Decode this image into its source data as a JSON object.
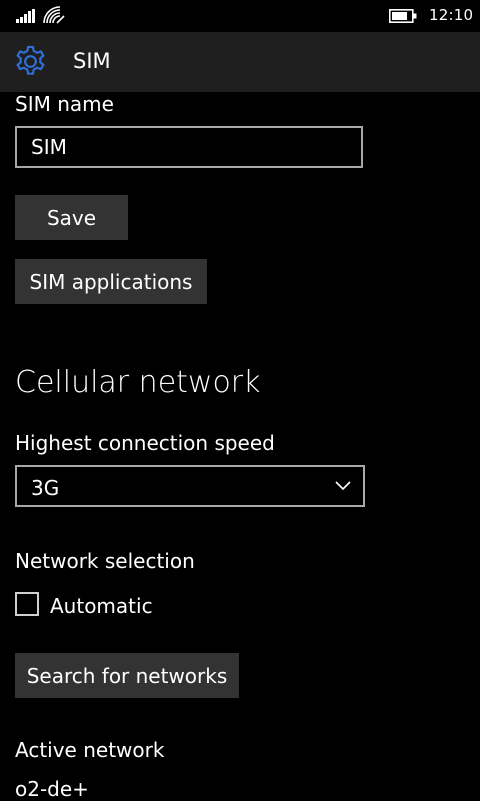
{
  "status_bar": {
    "time": "12:10",
    "signal_icon": "signal-bars-icon",
    "wifi_icon": "wifi-icon",
    "battery_icon": "battery-icon"
  },
  "header": {
    "title": "SIM",
    "icon": "gear-icon",
    "accent_color": "#2f6fd8"
  },
  "sim_name": {
    "label": "SIM name",
    "value": "SIM",
    "save_label": "Save",
    "apps_label": "SIM applications"
  },
  "cellular": {
    "title": "Cellular network",
    "speed_label": "Highest connection speed",
    "speed_value": "3G",
    "network_selection_label": "Network selection",
    "automatic_label": "Automatic",
    "automatic_checked": false,
    "search_label": "Search for networks",
    "active_network_label": "Active network",
    "active_network_value": "o2-de+"
  }
}
